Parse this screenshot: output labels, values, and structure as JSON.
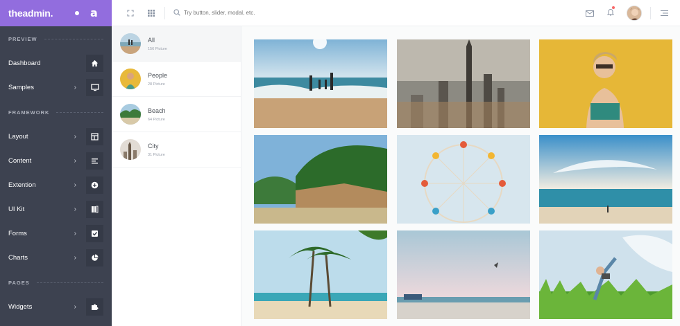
{
  "brand": {
    "logo": "theadmin.",
    "collapse_letter": "a"
  },
  "sidebar": {
    "sections": [
      {
        "header": "PREVIEW"
      },
      {
        "header": "FRAMEWORK"
      },
      {
        "header": "PAGES"
      }
    ],
    "items": [
      {
        "label": "Dashboard",
        "icon": "home-icon"
      },
      {
        "label": "Samples",
        "icon": "monitor-icon"
      },
      {
        "label": "Layout",
        "icon": "layout-icon"
      },
      {
        "label": "Content",
        "icon": "align-left-icon"
      },
      {
        "label": "Extention",
        "icon": "plus-circle-icon"
      },
      {
        "label": "UI Kit",
        "icon": "book-icon"
      },
      {
        "label": "Forms",
        "icon": "checkbox-icon"
      },
      {
        "label": "Charts",
        "icon": "pie-chart-icon"
      },
      {
        "label": "Widgets",
        "icon": "puzzle-icon"
      }
    ],
    "arrow": "›"
  },
  "topbar": {
    "search_placeholder": "Try button, slider, modal, etc."
  },
  "albums": [
    {
      "name": "All",
      "count": "156 Picture"
    },
    {
      "name": "People",
      "count": "28 Picture"
    },
    {
      "name": "Beach",
      "count": "64 Picture"
    },
    {
      "name": "City",
      "count": "31 Picture"
    }
  ],
  "colors": {
    "brand": "#926dde",
    "sidebar": "#3d4250",
    "notification": "#f96868"
  }
}
